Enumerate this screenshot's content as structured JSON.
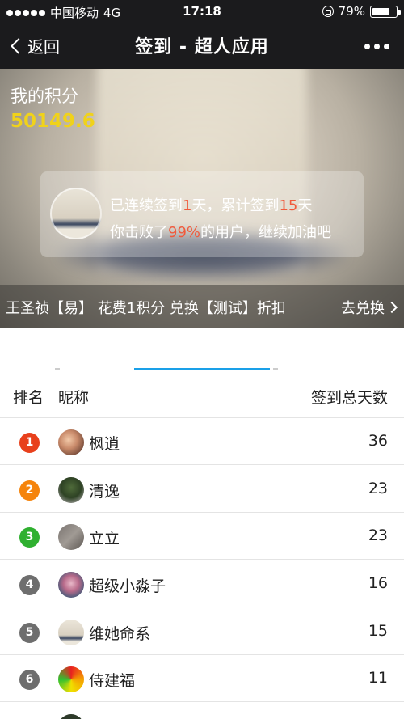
{
  "status_bar": {
    "carrier": "中国移动",
    "network": "4G",
    "time": "17:18",
    "battery": "79%",
    "battery_level": 0.79
  },
  "nav": {
    "back_label": "返回",
    "title": "签到 - 超人应用",
    "more_icon": "more-dots-icon"
  },
  "hero": {
    "score_label": "我的积分",
    "score_value": "50149.6",
    "score_color": "#f0d21a",
    "card": {
      "l1_a": "已连续签到",
      "l1_streak": "1",
      "l1_b": "天，累计签到",
      "l1_total": "15",
      "l1_c": "天",
      "l2_a": "你击败了",
      "l2_pct": "99%",
      "l2_b": "的用户，继续加油吧",
      "highlight_color": "#f05a3c"
    },
    "ticker_text": "王圣祯【易】 花费1积分 兑换【测试】折扣",
    "exchange_label": "去兑换"
  },
  "table": {
    "headers": {
      "rank": "排名",
      "nickname": "昵称",
      "days": "签到总天数"
    },
    "rows": [
      {
        "rank": "1",
        "name": "枫逍",
        "days": "36",
        "badge_color": "#e8401c"
      },
      {
        "rank": "2",
        "name": "清逸",
        "days": "23",
        "badge_color": "#f5840c"
      },
      {
        "rank": "3",
        "name": "立立",
        "days": "23",
        "badge_color": "#2fb030"
      },
      {
        "rank": "4",
        "name": "超级小淼子",
        "days": "16",
        "badge_color": "#6e6e6e"
      },
      {
        "rank": "5",
        "name": "维她命系",
        "days": "15",
        "badge_color": "#6e6e6e"
      },
      {
        "rank": "6",
        "name": "侍建福",
        "days": "11",
        "badge_color": "#6e6e6e"
      }
    ]
  }
}
